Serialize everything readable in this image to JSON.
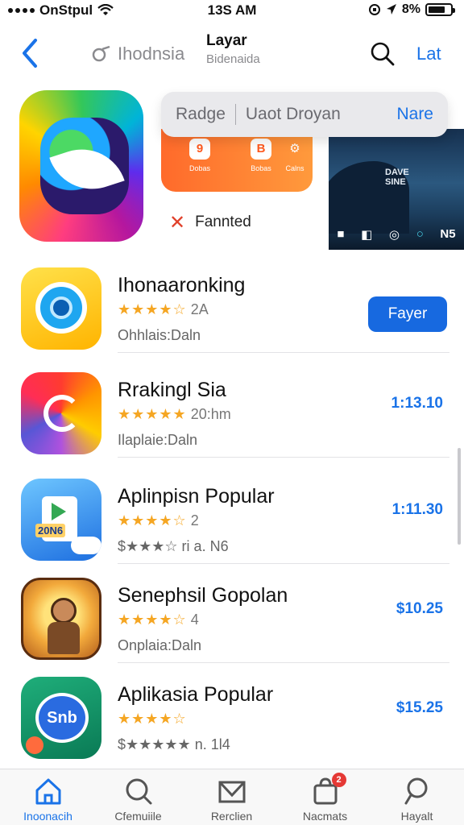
{
  "status_bar": {
    "carrier": "OnStpul",
    "time": "13S AM",
    "battery": "8%"
  },
  "nav": {
    "source_label": "Ihodnsia",
    "title": "Layar",
    "subtitle": "Bidenaida",
    "action_label": "Lat"
  },
  "featured": {
    "search_left": "Radge",
    "search_right": "Uaot Droyan",
    "search_name": "Nare",
    "featured_label": "Fannted",
    "promo_tiles": [
      "9",
      "B",
      "⚙"
    ],
    "promo_captions": [
      "Dobas",
      "Bobas",
      "Calns"
    ],
    "landscape_overlay": "DAVE\nSINE",
    "landscape_bar": [
      "■",
      "◧",
      "◎",
      "○",
      "N5"
    ]
  },
  "apps": [
    {
      "title": "Ihonaaronking",
      "stars": "★★★★☆",
      "rating_text": "2A",
      "meta": "Ohhlais:Daln",
      "action_type": "button",
      "action": "Fayer"
    },
    {
      "title": "Rrakingl Sia",
      "stars": "★★★★★",
      "rating_text": "20:hm",
      "meta": "Ilaplaie:Daln",
      "action_type": "price",
      "action": "1:13.10"
    },
    {
      "title": "Aplinpisn Popular",
      "stars": "★★★★☆",
      "rating_text": "2",
      "meta": "$★★★☆ ri a. N6",
      "action_type": "price",
      "action": "1:11.30",
      "icon_text": "20N6"
    },
    {
      "title": "Senephsil Gopolan",
      "stars": "★★★★☆",
      "rating_text": "4",
      "meta": "Onplaia:Daln",
      "action_type": "price",
      "action": "$10.25"
    },
    {
      "title": "Aplikasia Popular",
      "stars": "★★★★☆",
      "rating_text": "",
      "meta": "$★★★★★ n. 1l4",
      "action_type": "price",
      "action": "$15.25",
      "icon_text": "Snb"
    }
  ],
  "tabs": [
    {
      "label": "Inoonacih",
      "icon": "home-icon",
      "active": true
    },
    {
      "label": "Cfemuiile",
      "icon": "search-icon",
      "active": false
    },
    {
      "label": "Rerclien",
      "icon": "mail-icon",
      "active": false
    },
    {
      "label": "Nacmats",
      "icon": "bag-icon",
      "active": false,
      "badge": "2"
    },
    {
      "label": "Hayalt",
      "icon": "search-icon",
      "active": false
    }
  ],
  "colors": {
    "accent": "#1a73e8",
    "button": "#1769e0",
    "star": "#f5a623",
    "badge": "#e53935"
  }
}
